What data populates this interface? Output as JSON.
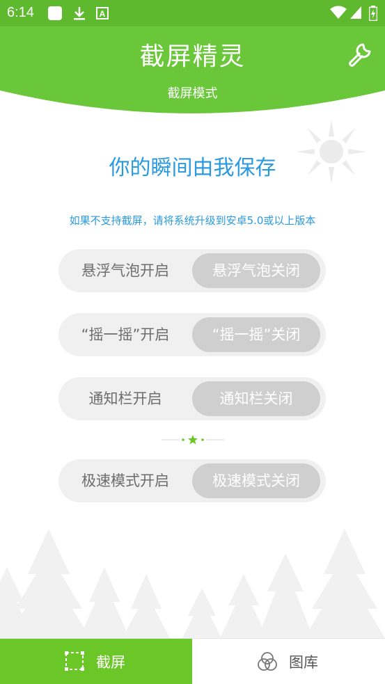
{
  "status_bar": {
    "time": "6:14",
    "icons": [
      "app-square-icon",
      "download-icon",
      "a-badge-icon",
      "wifi-icon",
      "signal-icon",
      "battery-icon"
    ]
  },
  "header": {
    "title": "截屏精灵",
    "subtitle": "截屏模式",
    "background_color": "#6bc73a",
    "settings_icon": "wrench-icon"
  },
  "main": {
    "slogan": "你的瞬间由我保存",
    "notice": "如果不支持截屏，请将系统升级到安卓5.0或以上版本",
    "accent_color": "#2a9ae0",
    "toggles": [
      {
        "on_label": "悬浮气泡开启",
        "off_label": "悬浮气泡关闭"
      },
      {
        "on_label": "“摇一摇”开启",
        "off_label": "“摇一摇”关闭"
      },
      {
        "on_label": "通知栏开启",
        "off_label": "通知栏关闭"
      },
      {
        "on_label": "极速模式开启",
        "off_label": "极速模式关闭"
      }
    ]
  },
  "bottom_nav": {
    "tabs": [
      {
        "label": "截屏",
        "icon": "screenshot-frame-icon",
        "active": true
      },
      {
        "label": "图库",
        "icon": "gallery-circles-icon",
        "active": false
      }
    ],
    "active_color": "#6bc628"
  }
}
